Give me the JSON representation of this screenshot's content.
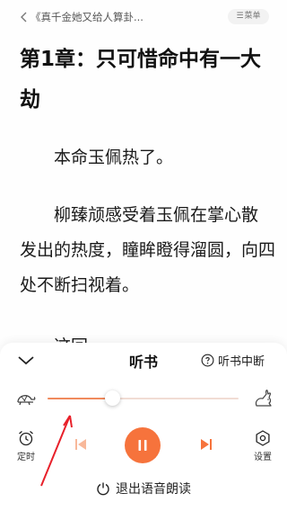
{
  "header": {
    "book_title": "《真千金她又给人算卦...",
    "menu_label": "菜单",
    "menu_glyph": "☰"
  },
  "content": {
    "chapter_title": "第1章：只可惜命中有一大劫",
    "paragraphs": [
      "本命玉佩热了。",
      "柳臻颃感受着玉佩在掌心散发出的热度，瞳眸瞪得溜圆，向四处不断扫视着。",
      "这回"
    ]
  },
  "player": {
    "title": "听书",
    "interrupt_label": "听书中断",
    "speed_level": 0.34,
    "timer_label": "定时",
    "settings_label": "设置",
    "exit_label": "退出语音朗读",
    "accent_color": "#f6733c",
    "annotation_color": "#e8202a",
    "icons": [
      "chevron-down-icon",
      "help-circle-icon",
      "turtle-icon",
      "rabbit-icon",
      "alarm-clock-icon",
      "skip-previous-icon",
      "pause-icon",
      "skip-next-icon",
      "gear-icon",
      "power-icon"
    ]
  }
}
